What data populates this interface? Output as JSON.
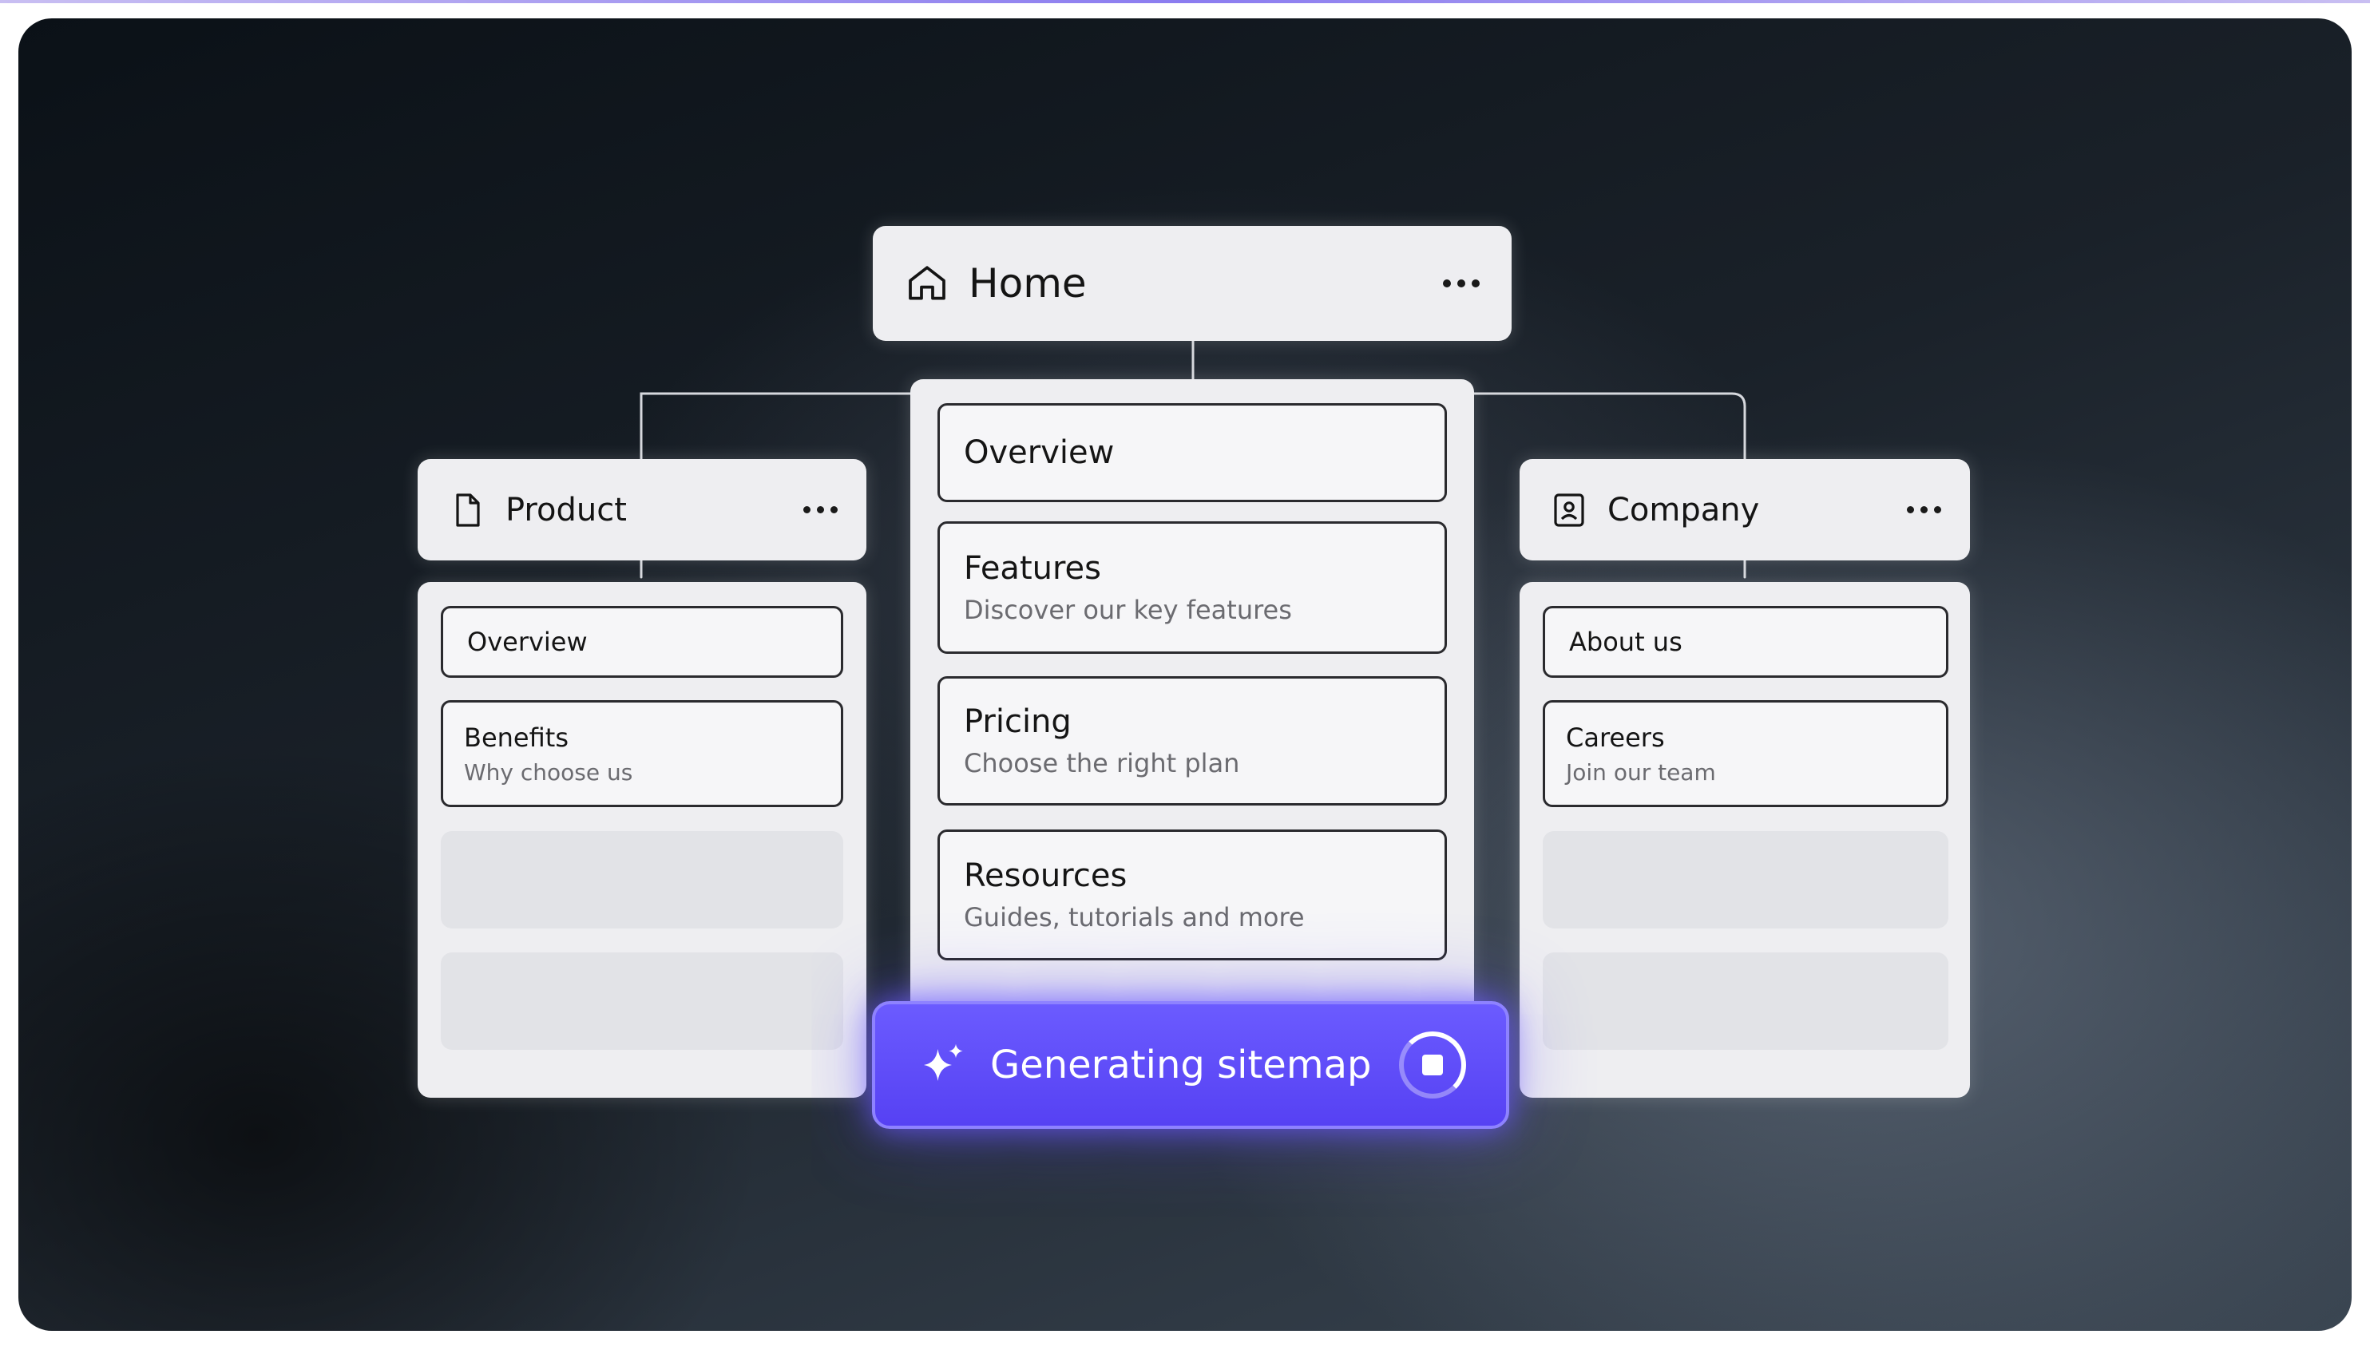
{
  "home": {
    "title": "Home",
    "icon": "home-icon"
  },
  "home_items": [
    {
      "title": "Overview",
      "subtitle": ""
    },
    {
      "title": "Features",
      "subtitle": "Discover our key features"
    },
    {
      "title": "Pricing",
      "subtitle": "Choose the right plan"
    },
    {
      "title": "Resources",
      "subtitle": "Guides, tutorials and more"
    }
  ],
  "product": {
    "title": "Product",
    "icon": "page-icon",
    "items": [
      {
        "title": "Overview",
        "subtitle": ""
      },
      {
        "title": "Benefits",
        "subtitle": "Why choose us"
      }
    ]
  },
  "company": {
    "title": "Company",
    "icon": "contact-card-icon",
    "items": [
      {
        "title": "About us",
        "subtitle": ""
      },
      {
        "title": "Careers",
        "subtitle": "Join our team"
      }
    ]
  },
  "generate": {
    "label": "Generating sitemap",
    "icon": "sparkle-icon",
    "stop_icon": "stop-icon"
  },
  "colors": {
    "accent": "#5a46f5",
    "card": "#eeeef1",
    "background": "#1a2129"
  }
}
